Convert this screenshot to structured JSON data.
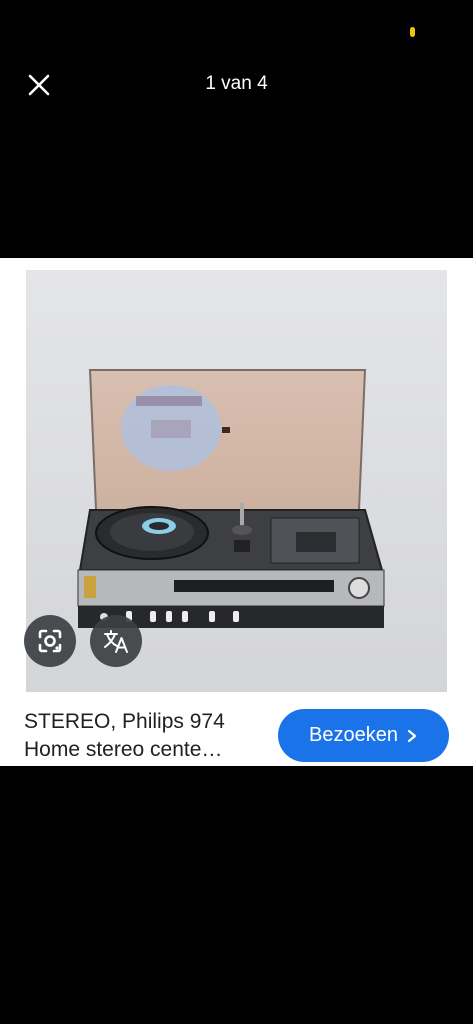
{
  "header": {
    "counter": "1 van 4"
  },
  "result": {
    "title_line1": "STEREO, Philips 974",
    "title_line2": "Home stereo cente…",
    "visit_label": "Bezoeken"
  },
  "icons": {
    "close": "close-icon",
    "lens": "google-lens-icon",
    "translate": "translate-icon",
    "chevron": "chevron-right-icon"
  },
  "colors": {
    "accent": "#1a73e8",
    "status_dot": "#f4c20d"
  }
}
